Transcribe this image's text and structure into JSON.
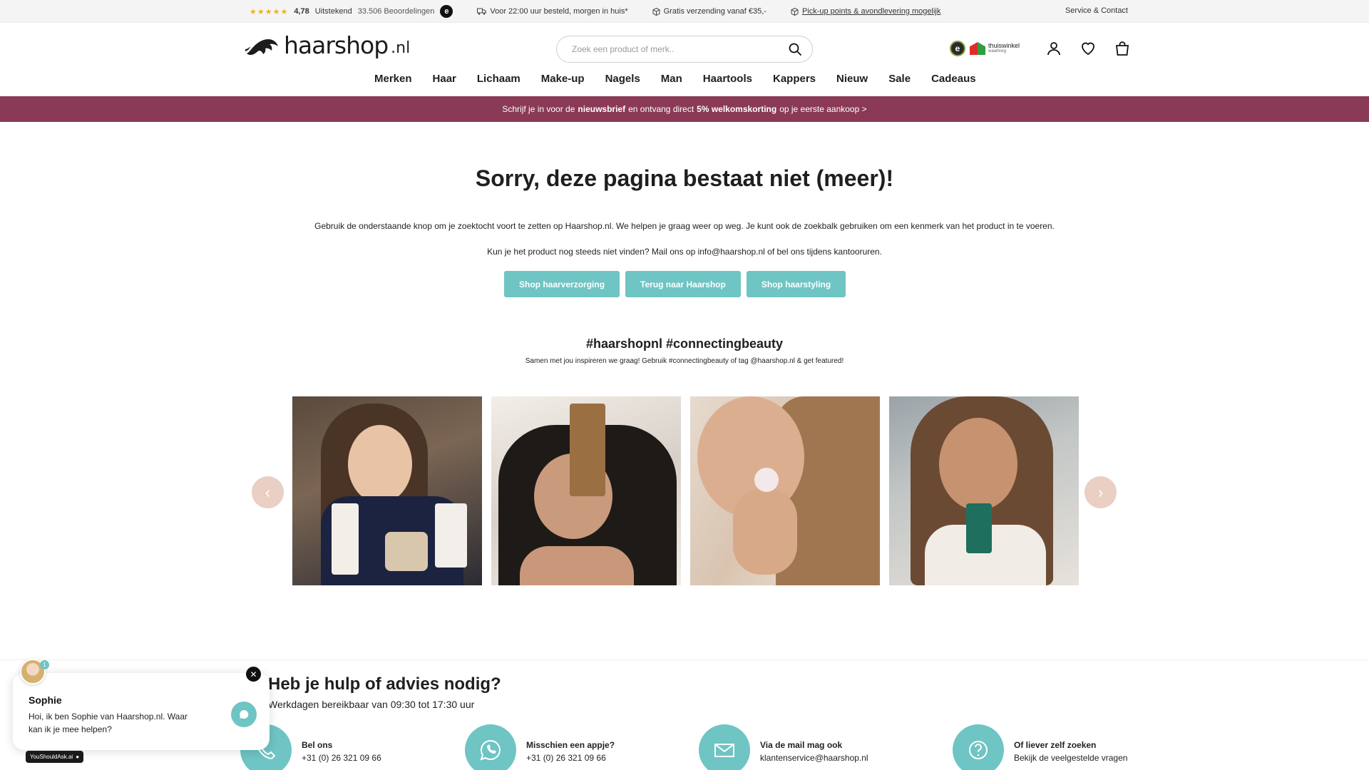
{
  "topbar": {
    "stars": "★★★★★",
    "rating": "4,78",
    "rating_word": "Uitstekend",
    "reviews": "33.506 Beoordelingen",
    "trust_badge": "e",
    "usp1": "Voor 22:00 uur besteld, morgen in huis*",
    "usp2": "Gratis verzending vanaf €35,-",
    "usp3": "Pick-up points & avondlevering mogelijk",
    "service": "Service & Contact"
  },
  "header": {
    "logo_word": "haarshop",
    "logo_tld": ".nl",
    "search_placeholder": "Zoek een product of merk..",
    "trust_e": "e",
    "thuiswinkel": "thuiswinkel",
    "thuiswinkel_sub": "waarborg"
  },
  "nav": [
    "Merken",
    "Haar",
    "Lichaam",
    "Make-up",
    "Nagels",
    "Man",
    "Haartools",
    "Kappers",
    "Nieuw",
    "Sale",
    "Cadeaus"
  ],
  "promo": {
    "pre": "Schrijf je in voor de",
    "b1": "nieuwsbrief",
    "mid": "en ontvang direct",
    "b2": "5% welkomskorting",
    "post": "op je eerste aankoop >"
  },
  "main": {
    "title": "Sorry, deze pagina bestaat niet (meer)!",
    "p1": "Gebruik de onderstaande knop om je zoektocht voort te zetten op Haarshop.nl. We helpen je graag weer op weg. Je kunt ook de zoekbalk gebruiken om een kenmerk van het product in te voeren.",
    "p2": "Kun je het product nog steeds niet vinden? Mail ons op info@haarshop.nl of bel ons tijdens kantooruren.",
    "buttons": [
      "Shop haarverzorging",
      "Terug naar Haarshop",
      "Shop haarstyling"
    ],
    "hashtag": "#haarshopnl #connectingbeauty",
    "hashtag_sub": "Samen met jou inspireren we graag! Gebruik #connectingbeauty of tag @haarshop.nl & get featured!"
  },
  "carousel": {
    "prev": "‹",
    "next": "›"
  },
  "help": {
    "title": "Heb je hulp of advies nodig?",
    "sub": "Werkdagen bereikbaar van 09:30 tot 17:30 uur",
    "contacts": [
      {
        "title": "Bel ons",
        "detail": "+31 (0) 26 321 09 66",
        "icon": "phone-icon"
      },
      {
        "title": "Misschien een appje?",
        "detail": "+31 (0) 26 321 09 66",
        "icon": "whatsapp-icon"
      },
      {
        "title": "Via de mail mag ook",
        "detail": "klantenservice@haarshop.nl",
        "icon": "mail-icon"
      },
      {
        "title": "Of liever zelf zoeken",
        "detail": "Bekijk de veelgestelde vragen",
        "icon": "question-icon"
      }
    ]
  },
  "chat": {
    "name": "Sophie",
    "message": "Hoi, ik ben Sophie van Haarshop.nl. Waar kan ik je mee helpen?",
    "badge": "1",
    "close": "✕",
    "powered": "YouShouldAsk.ai"
  },
  "colors": {
    "accent": "#6fc4c4",
    "promo": "#8a3a56",
    "arrow": "#e9cfc4"
  }
}
